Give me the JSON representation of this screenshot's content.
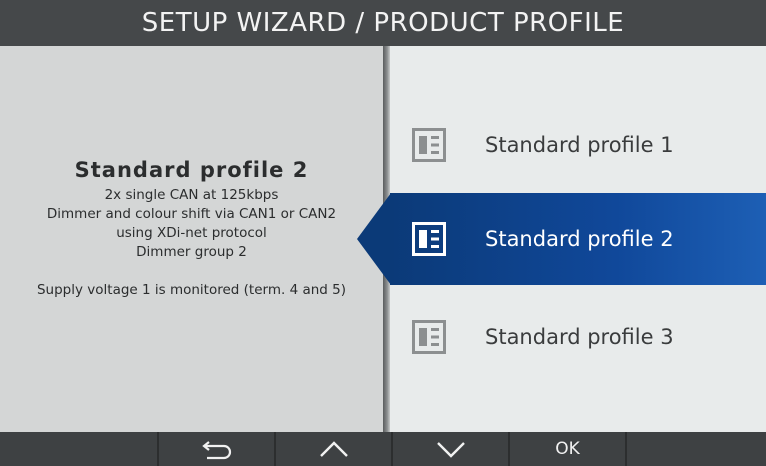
{
  "header": {
    "title": "SETUP WIZARD / PRODUCT PROFILE"
  },
  "details": {
    "title": "Standard profile 2",
    "lines": [
      "2x single CAN at 125kbps",
      "Dimmer and colour shift via CAN1 or CAN2",
      "using XDi-net protocol",
      "Dimmer group 2"
    ],
    "note": "Supply voltage 1 is monitored (term. 4 and 5)"
  },
  "profiles": [
    {
      "label": "Standard profile 1",
      "icon": "profile-card-icon",
      "selected": false
    },
    {
      "label": "Standard profile 2",
      "icon": "profile-card-icon",
      "selected": true
    },
    {
      "label": "Standard profile 3",
      "icon": "profile-card-icon",
      "selected": false
    }
  ],
  "bottom_bar": {
    "back_icon": "return-arrow-icon",
    "up_icon": "chevron-up-icon",
    "down_icon": "chevron-down-icon",
    "ok_label": "OK"
  },
  "colors": {
    "selected": "#0b3a78",
    "header": "#45484a",
    "left_panel": "#d4d6d6",
    "right_panel": "#e8ebeb"
  }
}
